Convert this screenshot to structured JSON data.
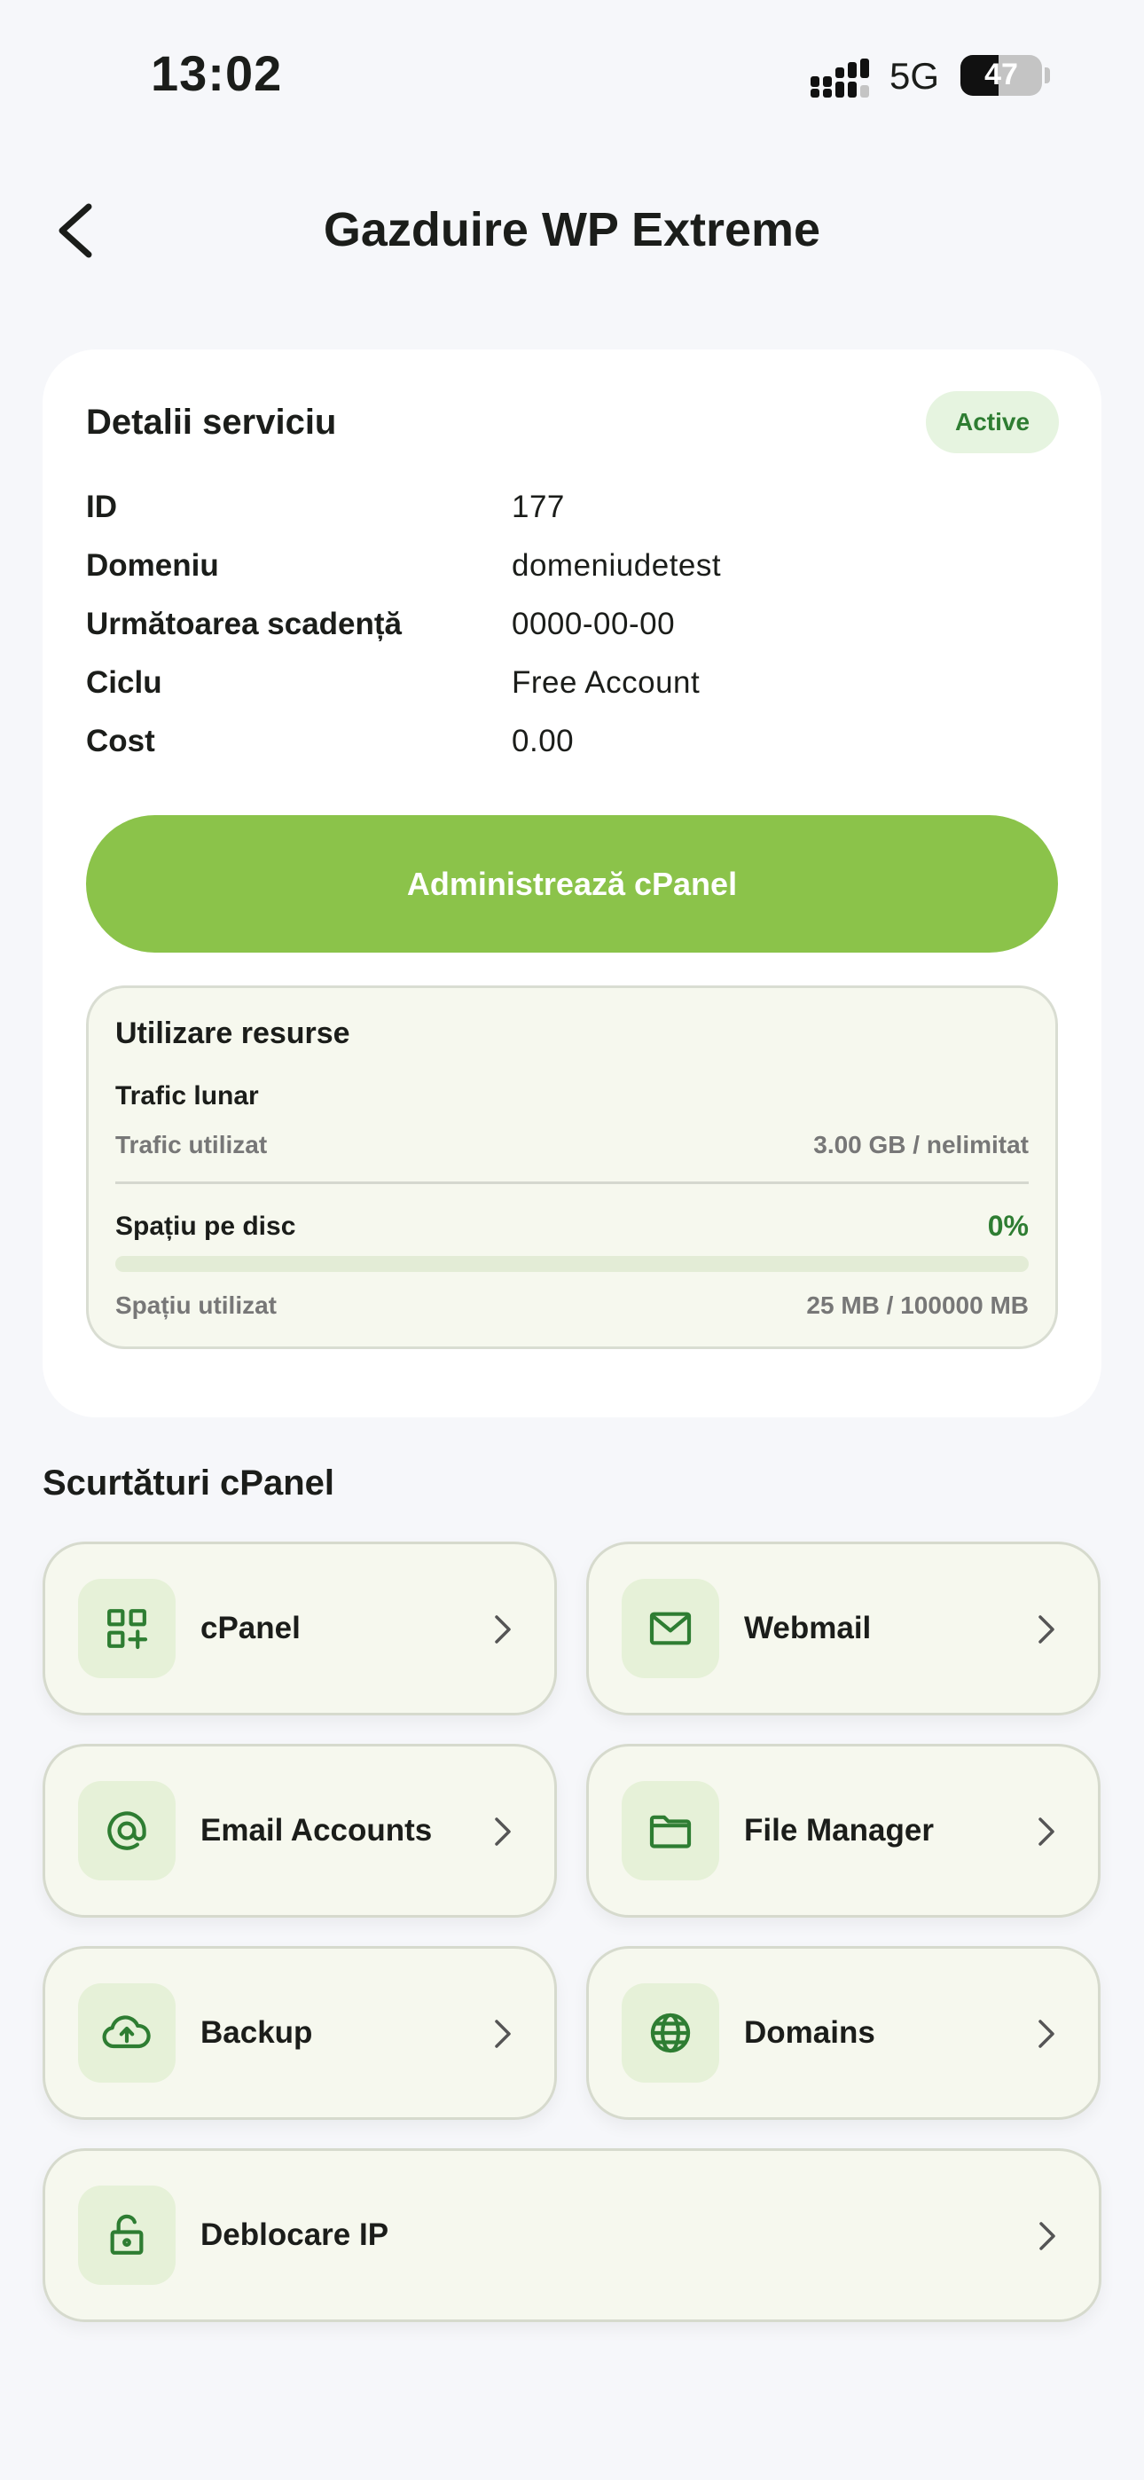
{
  "status_bar": {
    "time": "13:02",
    "network": "5G",
    "battery": "47",
    "battery_level": 0.47
  },
  "header": {
    "title": "Gazduire WP Extreme"
  },
  "details": {
    "title": "Detalii serviciu",
    "status": "Active",
    "rows": [
      {
        "label": "ID",
        "value": "177"
      },
      {
        "label": "Domeniu",
        "value": "domeniudetest"
      },
      {
        "label": "Următoarea scadență",
        "value": "0000-00-00"
      },
      {
        "label": "Ciclu",
        "value": "Free Account"
      },
      {
        "label": "Cost",
        "value": "0.00"
      }
    ],
    "cpanel_button": "Administrează cPanel"
  },
  "resources": {
    "title": "Utilizare resurse",
    "traffic": {
      "title": "Trafic lunar",
      "label": "Trafic utilizat",
      "value": "3.00 GB / nelimitat"
    },
    "disk": {
      "title": "Spațiu pe disc",
      "percent": "0%",
      "usage_fraction": 0.0,
      "label": "Spațiu utilizat",
      "value": "25 MB / 100000 MB"
    }
  },
  "shortcuts": {
    "title": "Scurtături cPanel",
    "items": [
      {
        "label": "cPanel",
        "icon": "apps-add-icon"
      },
      {
        "label": "Webmail",
        "icon": "mail-icon"
      },
      {
        "label": "Email Accounts",
        "icon": "at-sign-icon"
      },
      {
        "label": "File Manager",
        "icon": "folder-icon"
      },
      {
        "label": "Backup",
        "icon": "cloud-upload-icon"
      },
      {
        "label": "Domains",
        "icon": "globe-icon"
      },
      {
        "label": "Deblocare IP",
        "icon": "unlock-icon"
      }
    ]
  },
  "colors": {
    "accent": "#8bc34a",
    "accent_dark": "#2e7d32",
    "tile_bg": "#f6f8ee",
    "page_bg": "#f6f7fa"
  }
}
